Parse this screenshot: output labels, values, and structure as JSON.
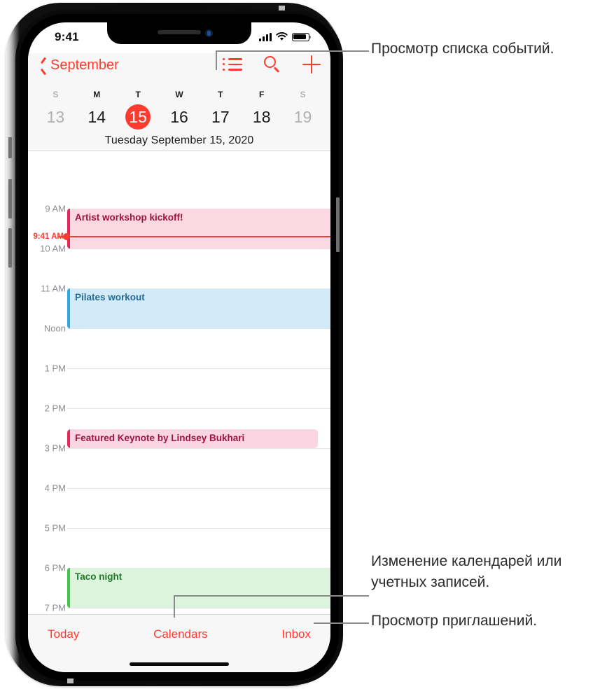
{
  "status_bar": {
    "time": "9:41",
    "icons": [
      "cellular-signal-icon",
      "wifi-icon",
      "battery-icon"
    ]
  },
  "nav_bar": {
    "back_label": "September",
    "back_icon": "chevron-left-icon",
    "actions": [
      {
        "name": "list-view-button",
        "icon": "list-bullet-icon"
      },
      {
        "name": "search-button",
        "icon": "magnifier-icon"
      },
      {
        "name": "add-event-button",
        "icon": "plus-icon"
      }
    ]
  },
  "week_strip": {
    "day_initials": [
      "S",
      "M",
      "T",
      "W",
      "T",
      "F",
      "S"
    ],
    "dates": [
      {
        "num": "13",
        "state": "dim"
      },
      {
        "num": "14",
        "state": "normal"
      },
      {
        "num": "15",
        "state": "today"
      },
      {
        "num": "16",
        "state": "normal"
      },
      {
        "num": "17",
        "state": "normal"
      },
      {
        "num": "18",
        "state": "normal"
      },
      {
        "num": "19",
        "state": "dim"
      }
    ],
    "full_date": "Tuesday  September 15, 2020"
  },
  "day_view": {
    "hours": [
      "9 AM",
      "10 AM",
      "11 AM",
      "Noon",
      "1 PM",
      "2 PM",
      "3 PM",
      "4 PM",
      "5 PM",
      "6 PM",
      "7 PM"
    ],
    "current_time_label": "9:41 AM",
    "current_time_color": "#ff3b30",
    "events": [
      {
        "title": "Artist workshop kickoff!",
        "bar_color": "#e8245c",
        "fill_color": "#fcd8e3",
        "text_color": "#9d1440",
        "start_hour_index": 0,
        "end_hour_index": 1
      },
      {
        "title": "Pilates workout",
        "bar_color": "#2eaae1",
        "fill_color": "#d3ebf9",
        "text_color": "#246b93",
        "start_hour_index": 2,
        "end_hour_index": 3
      },
      {
        "title": "Featured Keynote by Lindsey Bukhari",
        "bar_color": "#e8245c",
        "fill_color": "#fbd5e2",
        "text_color": "#9d1440",
        "start_hour_index": 5.52,
        "end_hour_index": 6
      },
      {
        "title": "Taco night",
        "bar_color": "#3fc34a",
        "fill_color": "#dcf3dc",
        "text_color": "#1d7a2a",
        "start_hour_index": 9,
        "end_hour_index": 10
      }
    ]
  },
  "tab_bar": {
    "tabs": [
      {
        "name": "tab-today",
        "label": "Today"
      },
      {
        "name": "tab-calendars",
        "label": "Calendars"
      },
      {
        "name": "tab-inbox",
        "label": "Inbox"
      }
    ]
  },
  "callouts": [
    {
      "name": "callout-list-view",
      "text": "Просмотр списка событий."
    },
    {
      "name": "callout-calendars",
      "text": "Изменение календарей или учетных записей."
    },
    {
      "name": "callout-inbox",
      "text": "Просмотр приглашений."
    }
  ],
  "colors": {
    "accent": "#ff3b30",
    "chrome_bg": "#f7f7f7",
    "separator": "#d9d9dc",
    "gridline": "#e3e3e5",
    "muted_text": "#8e8e93",
    "callout_text": "#2b2b2b",
    "leader_line": "#8a8a8a"
  }
}
